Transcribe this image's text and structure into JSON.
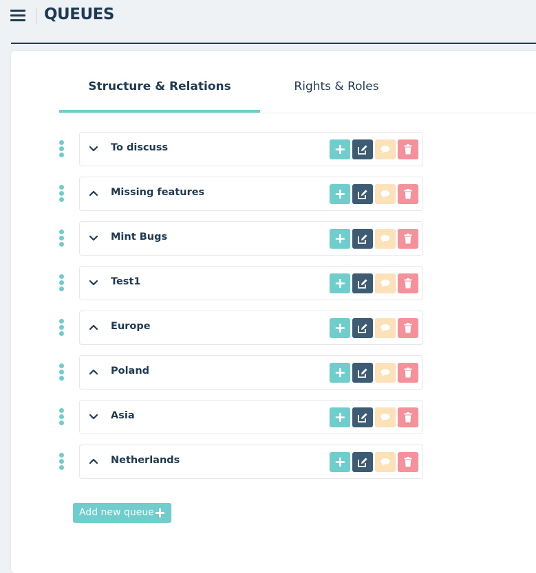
{
  "header": {
    "title": "QUEUES"
  },
  "tabs": [
    {
      "label": "Structure & Relations",
      "active": true
    },
    {
      "label": "Rights & Roles",
      "active": false
    }
  ],
  "queues": [
    {
      "name": "To discuss",
      "expanded": false
    },
    {
      "name": "Missing features",
      "expanded": true
    },
    {
      "name": "Mint Bugs",
      "expanded": false
    },
    {
      "name": "Test1",
      "expanded": false
    },
    {
      "name": "Europe",
      "expanded": true
    },
    {
      "name": "Poland",
      "expanded": true
    },
    {
      "name": "Asia",
      "expanded": false
    },
    {
      "name": "Netherlands",
      "expanded": true
    }
  ],
  "add_queue": {
    "label": "Add new queue"
  },
  "colors": {
    "accent": "#6fcdcb",
    "navy": "#1e3a52",
    "edit": "#3d5b73",
    "comment": "#fde1b8",
    "delete": "#f4919b"
  },
  "icons": {
    "menu": "hamburger-icon",
    "drag": "drag-handle-icon",
    "collapsed": "chevron-down-icon",
    "expanded": "chevron-up-icon",
    "add": "plus-icon",
    "edit": "edit-icon",
    "comment": "comment-icon",
    "delete": "trash-icon"
  }
}
